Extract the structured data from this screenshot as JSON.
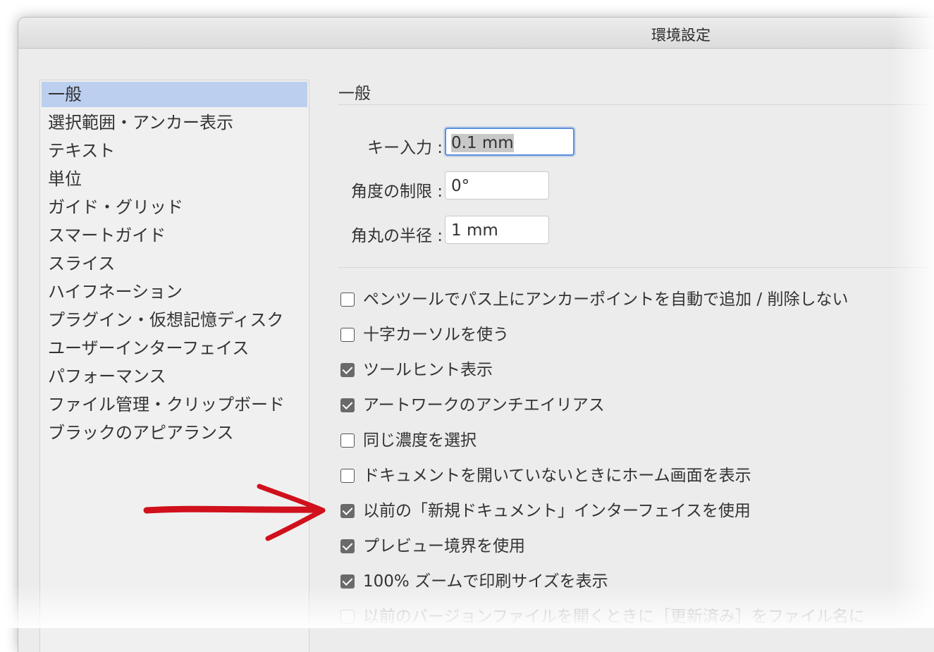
{
  "window": {
    "title": "環境設定"
  },
  "sidebar": {
    "items": [
      {
        "label": "一般",
        "selected": true
      },
      {
        "label": "選択範囲・アンカー表示"
      },
      {
        "label": "テキスト"
      },
      {
        "label": "単位"
      },
      {
        "label": "ガイド・グリッド"
      },
      {
        "label": "スマートガイド"
      },
      {
        "label": "スライス"
      },
      {
        "label": "ハイフネーション"
      },
      {
        "label": "プラグイン・仮想記憶ディスク"
      },
      {
        "label": "ユーザーインターフェイス"
      },
      {
        "label": "パフォーマンス"
      },
      {
        "label": "ファイル管理・クリップボード"
      },
      {
        "label": "ブラックのアピアランス"
      }
    ]
  },
  "main": {
    "section_title": "一般",
    "fields": [
      {
        "label": "キー入力 :",
        "value": "0.1 mm"
      },
      {
        "label": "角度の制限 :",
        "value": "0°"
      },
      {
        "label": "角丸の半径 :",
        "value": "1 mm"
      }
    ],
    "checkboxes": [
      {
        "label": "ペンツールでパス上にアンカーポイントを自動で追加 / 削除しない",
        "checked": false
      },
      {
        "label": "十字カーソルを使う",
        "checked": false
      },
      {
        "label": "ツールヒント表示",
        "checked": true
      },
      {
        "label": "アートワークのアンチエイリアス",
        "checked": true
      },
      {
        "label": "同じ濃度を選択",
        "checked": false
      },
      {
        "label": "ドキュメントを開いていないときにホーム画面を表示",
        "checked": false
      },
      {
        "label": "以前の「新規ドキュメント」インターフェイスを使用",
        "checked": true
      },
      {
        "label": "プレビュー境界を使用",
        "checked": true
      },
      {
        "label": "100% ズームで印刷サイズを表示",
        "checked": true
      },
      {
        "label": "以前のバージョンファイルを開くときに［更新済み］をファイル名に",
        "checked": false
      }
    ]
  },
  "colors": {
    "selection": "#bccfef",
    "focus_ring": "#5b8fdc",
    "annotation_arrow": "#d0101c"
  }
}
